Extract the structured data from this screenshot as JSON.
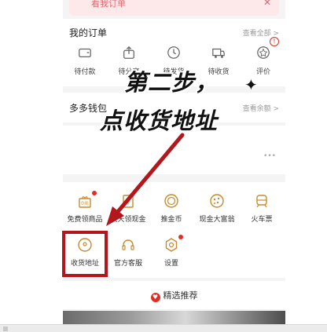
{
  "banner": {
    "text": "看我订单",
    "close": "✕"
  },
  "orders": {
    "title": "我的订单",
    "view_all": "查看全部 >",
    "badge": "!",
    "items": [
      {
        "label": "待付款",
        "icon": "wallet-icon"
      },
      {
        "label": "待分享",
        "icon": "share-icon"
      },
      {
        "label": "待发货",
        "icon": "clock-icon"
      },
      {
        "label": "待收货",
        "icon": "truck-icon"
      },
      {
        "label": "评价",
        "icon": "review-icon"
      }
    ]
  },
  "wallet": {
    "title": "多多钱包",
    "balance_link": "查看余额 >"
  },
  "blank": {
    "dots": "•••"
  },
  "services": {
    "row1": [
      {
        "label": "免费领商品",
        "icon": "gift-icon",
        "dot": true
      },
      {
        "label": "天天领现金",
        "icon": "cash-icon",
        "dot": false
      },
      {
        "label": "推金币",
        "icon": "coin-icon",
        "dot": false
      },
      {
        "label": "现金大富翁",
        "icon": "cookie-icon",
        "dot": false
      },
      {
        "label": "火车票",
        "icon": "train-icon",
        "dot": false
      }
    ],
    "row2": [
      {
        "label": "收货地址",
        "icon": "location-icon",
        "dot": false
      },
      {
        "label": "官方客服",
        "icon": "headset-icon",
        "dot": false
      },
      {
        "label": "设置",
        "icon": "gear-icon",
        "dot": true
      }
    ]
  },
  "recommend": {
    "label": "精选推荐",
    "icon": "heart-icon"
  },
  "overlay": {
    "step": "第二步，",
    "instruction": "点收货地址",
    "sparkle": "✦"
  },
  "colors": {
    "accent": "#e02e24",
    "annotation": "#b3171c",
    "banner": "#fde9ea"
  }
}
